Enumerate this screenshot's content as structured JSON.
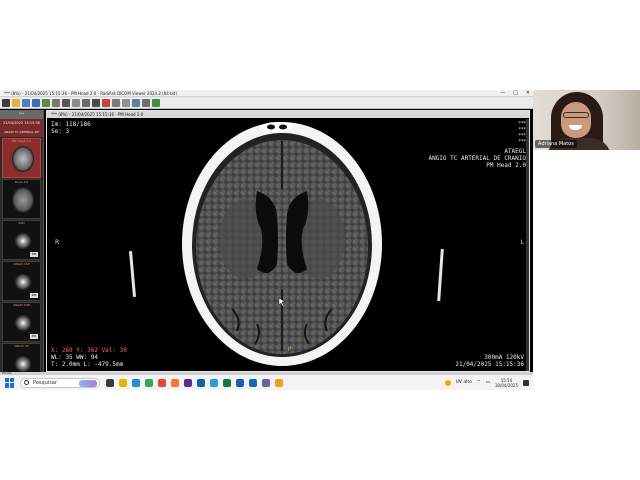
{
  "window": {
    "title": "*** (8%) - 21/04/2025 15:15:36 - PM Head 2.0 - RadiAnt DICOM Viewer 2024.2 (64-bit)",
    "controls": [
      "—",
      "□",
      "✕"
    ]
  },
  "toolbar": {
    "icons": [
      "menu-icon",
      "open-folder-icon",
      "import-icon",
      "save-icon",
      "export-icon",
      "print-icon",
      "layout-icon",
      "move-icon",
      "zoom-icon",
      "window-level-icon",
      "measure-icon",
      "angle-icon",
      "annotate-icon",
      "3d-icon",
      "settings-icon",
      "fullscreen-icon"
    ]
  },
  "sidebar": {
    "patient_name": "***",
    "study_header": "21/04/2025 15:15:36",
    "study_desc": "ANGIO TC ARTERIAL DE CRANIO",
    "series": [
      {
        "label": "PM Head 2.0",
        "badge": "",
        "active": true
      },
      {
        "label": "Bone 2.0",
        "badge": "",
        "active": false
      },
      {
        "label": "SSD",
        "badge": "PM",
        "active": false
      },
      {
        "label": "ANGIO MIP",
        "badge": "PM",
        "active": false
      },
      {
        "label": "ANGIO SUB",
        "badge": "PM",
        "active": false
      },
      {
        "label": "ANGIO VR",
        "badge": "PM",
        "active": false
      }
    ]
  },
  "viewer": {
    "tab_label": "*** (8%) - 21/04/2025 15:15:36 - PM Head 2.0",
    "image_info": "Im: 118/186",
    "series_info": "Se: 3",
    "stars": [
      "***",
      "***",
      "***",
      "***"
    ],
    "institution": "ATAEGL",
    "study": "ANGIO TC ARTERIAL DE CRANIO",
    "series_name": "PM Head 2.0",
    "left_marker": "R",
    "right_marker": "L",
    "bottom_marker": "P",
    "cursor_info": "X: 269 Y: 362 Val: 30",
    "window_info": "WL: 35 WW: 94",
    "slice_info": "T: 2.0mm L: -479.5mm",
    "acq_info": "300mA 120kV",
    "acq_date": "21/04/2025 15:15:36"
  },
  "statusbar": {
    "text": "Pronto"
  },
  "taskbar": {
    "search_placeholder": "Pesquisar",
    "apps": [
      {
        "name": "task-view-icon",
        "color": "#3a3a3a"
      },
      {
        "name": "file-explorer-icon",
        "color": "#e8b400"
      },
      {
        "name": "edge-icon",
        "color": "#1b8fd9"
      },
      {
        "name": "chrome-icon",
        "color": "#34a853"
      },
      {
        "name": "chrome-profile-icon",
        "color": "#ea4335"
      },
      {
        "name": "firefox-icon",
        "color": "#ff7139"
      },
      {
        "name": "store-icon",
        "color": "#5c2d91"
      },
      {
        "name": "mail-icon",
        "color": "#0a64ad"
      },
      {
        "name": "photos-icon",
        "color": "#2a9fd6"
      },
      {
        "name": "excel-icon",
        "color": "#107c41"
      },
      {
        "name": "word-icon",
        "color": "#185abd"
      },
      {
        "name": "outlook-icon",
        "color": "#0f6cbd"
      },
      {
        "name": "teams-icon",
        "color": "#6264a7"
      },
      {
        "name": "radiant-icon",
        "color": "#f0a020"
      }
    ],
    "weather": "UV alto",
    "time": "15:14",
    "date": "30/04/2025"
  },
  "webcam": {
    "participant_name": "Adriana Matos"
  }
}
